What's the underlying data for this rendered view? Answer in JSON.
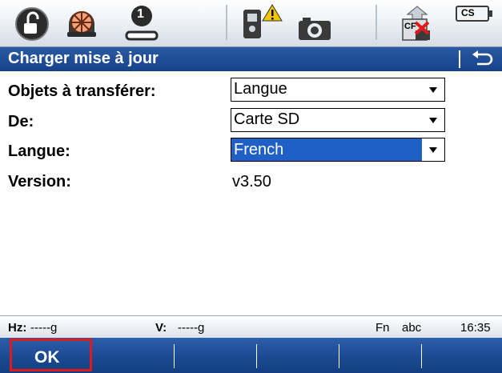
{
  "statusbar_icons": {
    "lock": "lock-icon",
    "prism": "prism-icon",
    "face": "face-one-icon",
    "face_number": "1",
    "instrument": "instrument-warning-icon",
    "camera": "camera-icon",
    "cf_card": "cf-card-icon",
    "cf_label": "CF",
    "cs_battery": "cs-battery-icon",
    "cs_label": "CS"
  },
  "titlebar": {
    "title": "Charger mise à jour",
    "back_icon": "back-arrow-icon"
  },
  "form": {
    "objects_label": "Objets à transférer:",
    "objects_value": "Langue",
    "from_label": "De:",
    "from_value": "Carte SD",
    "language_label": "Langue:",
    "language_value": "French",
    "version_label": "Version:",
    "version_value": "v3.50"
  },
  "status_line": {
    "hz_label": "Hz:",
    "hz_value": "-----g",
    "v_label": "V:",
    "v_value": "-----g",
    "fn": "Fn",
    "input_mode": "abc",
    "time": "16:35"
  },
  "softkeys": {
    "ok": "OK"
  },
  "colors": {
    "title_bg": "#1e4f98",
    "selection": "#1f5fc6",
    "highlight_border": "#e01a1a"
  }
}
